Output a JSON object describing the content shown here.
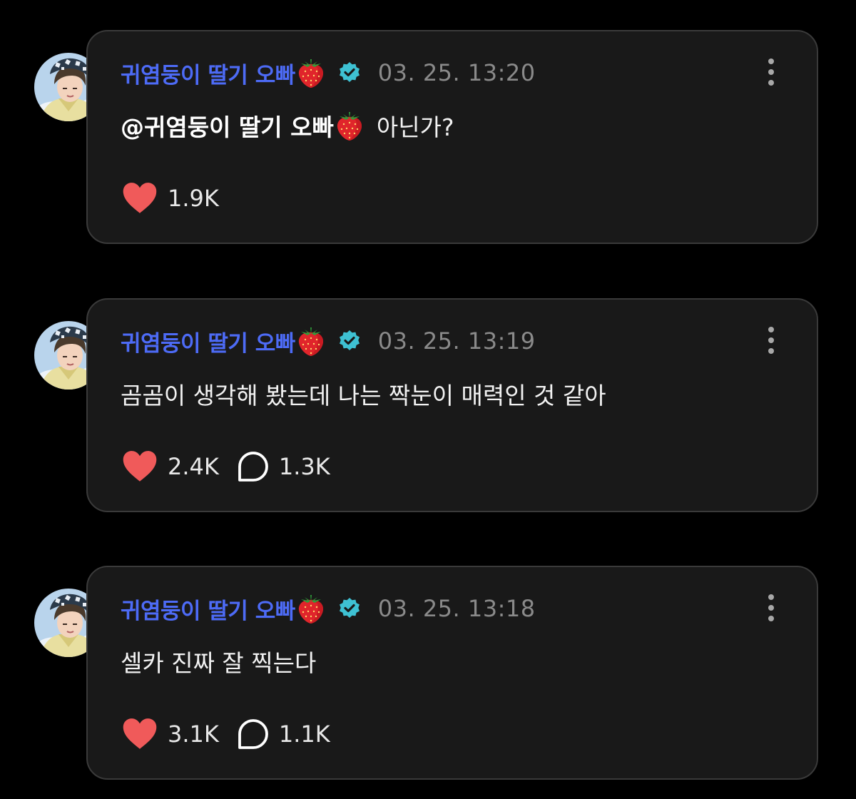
{
  "colors": {
    "background": "#000000",
    "card": "#191919",
    "card_border": "#3a3a3a",
    "author": "#4d6bf6",
    "verified": "#3ec1d3",
    "timestamp": "#8a8a8a",
    "heart": "#f05a5a"
  },
  "posts": [
    {
      "author": "귀염둥이 딸기 오빠",
      "author_emoji": "strawberry-icon",
      "verified": true,
      "timestamp": "03. 25. 13:20",
      "mention": "@귀염둥이 딸기 오빠",
      "text": "아닌가?",
      "likes": "1.9K"
    },
    {
      "author": "귀염둥이 딸기 오빠",
      "author_emoji": "strawberry-icon",
      "verified": true,
      "timestamp": "03. 25. 13:19",
      "text": "곰곰이 생각해 봤는데 나는 짝눈이 매력인 것 같아",
      "likes": "2.4K",
      "comments": "1.3K"
    },
    {
      "author": "귀염둥이 딸기 오빠",
      "author_emoji": "strawberry-icon",
      "verified": true,
      "timestamp": "03. 25. 13:18",
      "text": "셀카 진짜 잘 찍는다",
      "likes": "3.1K",
      "comments": "1.1K"
    }
  ]
}
